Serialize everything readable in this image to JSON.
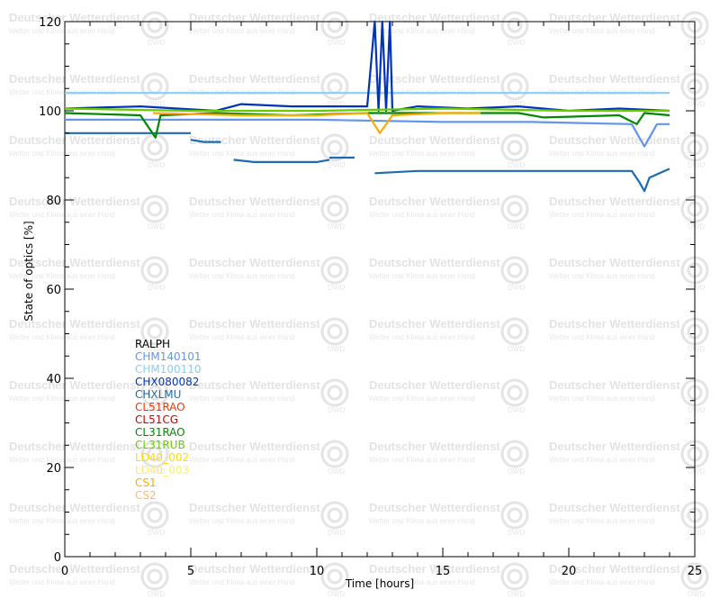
{
  "watermark": {
    "title": "Deutscher Wetterdienst",
    "subtitle": "Wetter und Klima aus einer Hand",
    "logo_text": "DWD"
  },
  "chart_data": {
    "type": "line",
    "title": "",
    "xlabel": "Time [hours]",
    "ylabel": "State of optics [%]",
    "xlim": [
      0,
      25
    ],
    "ylim": [
      0,
      120
    ],
    "xticks": [
      0,
      5,
      10,
      15,
      20,
      25
    ],
    "yticks": [
      0,
      20,
      40,
      60,
      80,
      100,
      120
    ],
    "grid": false,
    "legend_placement": "left-middle",
    "series": [
      {
        "name": "RALPH",
        "color": "#000000",
        "segments": []
      },
      {
        "name": "CHM140101",
        "color": "#6495ed",
        "segments": [
          [
            [
              0,
              98
            ],
            [
              5,
              98
            ],
            [
              10,
              98
            ],
            [
              15,
              97.5
            ],
            [
              18.5,
              97.5
            ],
            [
              22.5,
              97
            ],
            [
              22.8,
              94
            ],
            [
              23.0,
              92
            ],
            [
              23.2,
              94
            ],
            [
              23.5,
              97
            ],
            [
              24,
              97
            ]
          ]
        ]
      },
      {
        "name": "CHM100110",
        "color": "#87cefa",
        "segments": [
          [
            [
              0,
              104
            ],
            [
              5,
              104
            ],
            [
              10,
              104
            ],
            [
              12,
              104
            ],
            [
              12.7,
              104
            ],
            [
              15,
              104
            ],
            [
              20,
              104
            ],
            [
              22,
              104
            ],
            [
              24,
              104
            ]
          ]
        ]
      },
      {
        "name": "CHX080082",
        "color": "#0033bb",
        "segments": [
          [
            [
              0,
              100.5
            ],
            [
              3,
              101
            ],
            [
              6,
              100
            ],
            [
              7,
              101.5
            ],
            [
              9,
              101
            ],
            [
              12,
              101
            ],
            [
              12.3,
              120
            ],
            [
              12.45,
              100
            ],
            [
              12.6,
              120
            ],
            [
              12.75,
              100
            ],
            [
              12.9,
              120
            ],
            [
              13.0,
              100
            ],
            [
              14,
              101
            ],
            [
              16,
              100.5
            ],
            [
              18,
              101
            ],
            [
              20,
              100
            ],
            [
              22,
              100.5
            ],
            [
              24,
              100
            ]
          ]
        ]
      },
      {
        "name": "CHXLMU",
        "color": "#1f6bb0",
        "segments": [
          [
            [
              0,
              95
            ],
            [
              3,
              95
            ],
            [
              5,
              95
            ]
          ],
          [
            [
              5,
              93.5
            ],
            [
              5.5,
              93
            ],
            [
              6.2,
              93
            ]
          ],
          [
            [
              6.7,
              89
            ],
            [
              7.5,
              88.5
            ],
            [
              9,
              88.5
            ],
            [
              10,
              88.5
            ],
            [
              10.5,
              89
            ]
          ],
          [
            [
              10.5,
              89.5
            ],
            [
              11.5,
              89.5
            ]
          ],
          [
            [
              12.3,
              86
            ],
            [
              14,
              86.5
            ],
            [
              16,
              86.5
            ],
            [
              18,
              86.5
            ],
            [
              20,
              86.5
            ],
            [
              22.5,
              86.5
            ],
            [
              22.8,
              84
            ],
            [
              23.0,
              82
            ],
            [
              23.2,
              85
            ],
            [
              23.6,
              86
            ],
            [
              24,
              87
            ]
          ]
        ]
      },
      {
        "name": "CL51RAO",
        "color": "#ff3300",
        "segments": []
      },
      {
        "name": "CL51CG",
        "color": "#cc0000",
        "segments": []
      },
      {
        "name": "CL31RAO",
        "color": "#008800",
        "segments": [
          [
            [
              0,
              99.5
            ],
            [
              3,
              99
            ],
            [
              3.6,
              94
            ],
            [
              3.8,
              99
            ],
            [
              6,
              99.5
            ],
            [
              9,
              99
            ],
            [
              12,
              99.5
            ],
            [
              15,
              99.5
            ],
            [
              18,
              99.5
            ],
            [
              19,
              98.5
            ],
            [
              22,
              99
            ],
            [
              22.7,
              97
            ],
            [
              23.0,
              99.5
            ],
            [
              24,
              99
            ]
          ]
        ]
      },
      {
        "name": "CL31RUB",
        "color": "#66cc00",
        "segments": [
          [
            [
              0,
              100.5
            ],
            [
              5,
              100
            ],
            [
              10,
              100
            ],
            [
              15,
              100.5
            ],
            [
              20,
              100
            ],
            [
              24,
              100
            ]
          ]
        ]
      },
      {
        "name": "LD40_002",
        "color": "#ffdd00",
        "segments": []
      },
      {
        "name": "LD40_003",
        "color": "#ffee66",
        "segments": []
      },
      {
        "name": "CS1",
        "color": "#ffaa00",
        "segments": [
          [
            [
              3.5,
              99.5
            ],
            [
              7,
              99
            ],
            [
              10,
              99
            ],
            [
              12,
              99.5
            ],
            [
              12.5,
              95
            ],
            [
              13,
              99
            ],
            [
              15,
              99.5
            ],
            [
              16.5,
              99.5
            ]
          ]
        ]
      },
      {
        "name": "CS2",
        "color": "#ffbb66",
        "segments": []
      }
    ]
  }
}
